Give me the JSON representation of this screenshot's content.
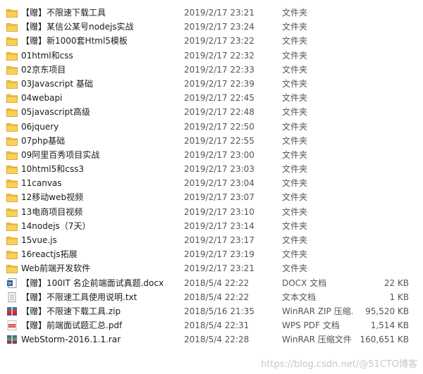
{
  "files": [
    {
      "name": "【赠】不限速下载工具",
      "date": "2019/2/17 23:21",
      "type": "文件夹",
      "size": "",
      "icon": "folder-icon"
    },
    {
      "name": "【赠】某信公某号nodejs实战",
      "date": "2019/2/17 23:24",
      "type": "文件夹",
      "size": "",
      "icon": "folder-icon"
    },
    {
      "name": "【赠】新1000套Html5模板",
      "date": "2019/2/17 23:22",
      "type": "文件夹",
      "size": "",
      "icon": "folder-icon"
    },
    {
      "name": "01html和css",
      "date": "2019/2/17 22:32",
      "type": "文件夹",
      "size": "",
      "icon": "folder-icon"
    },
    {
      "name": "02京东项目",
      "date": "2019/2/17 22:33",
      "type": "文件夹",
      "size": "",
      "icon": "folder-icon"
    },
    {
      "name": "03Javascript 基础",
      "date": "2019/2/17 22:39",
      "type": "文件夹",
      "size": "",
      "icon": "folder-icon"
    },
    {
      "name": "04webapi",
      "date": "2019/2/17 22:45",
      "type": "文件夹",
      "size": "",
      "icon": "folder-icon"
    },
    {
      "name": "05javascript高级",
      "date": "2019/2/17 22:48",
      "type": "文件夹",
      "size": "",
      "icon": "folder-icon"
    },
    {
      "name": "06jquery",
      "date": "2019/2/17 22:50",
      "type": "文件夹",
      "size": "",
      "icon": "folder-icon"
    },
    {
      "name": "07php基础",
      "date": "2019/2/17 22:55",
      "type": "文件夹",
      "size": "",
      "icon": "folder-icon"
    },
    {
      "name": "09阿里百秀项目实战",
      "date": "2019/2/17 23:00",
      "type": "文件夹",
      "size": "",
      "icon": "folder-icon"
    },
    {
      "name": "10html5和css3",
      "date": "2019/2/17 23:03",
      "type": "文件夹",
      "size": "",
      "icon": "folder-icon"
    },
    {
      "name": "11canvas",
      "date": "2019/2/17 23:04",
      "type": "文件夹",
      "size": "",
      "icon": "folder-icon"
    },
    {
      "name": "12移动web视频",
      "date": "2019/2/17 23:07",
      "type": "文件夹",
      "size": "",
      "icon": "folder-icon"
    },
    {
      "name": "13电商项目视频",
      "date": "2019/2/17 23:10",
      "type": "文件夹",
      "size": "",
      "icon": "folder-icon"
    },
    {
      "name": "14nodejs（7天）",
      "date": "2019/2/17 23:14",
      "type": "文件夹",
      "size": "",
      "icon": "folder-icon"
    },
    {
      "name": "15vue.js",
      "date": "2019/2/17 23:17",
      "type": "文件夹",
      "size": "",
      "icon": "folder-icon"
    },
    {
      "name": "16reactjs拓展",
      "date": "2019/2/17 23:19",
      "type": "文件夹",
      "size": "",
      "icon": "folder-icon"
    },
    {
      "name": "Web前端开发软件",
      "date": "2019/2/17 23:21",
      "type": "文件夹",
      "size": "",
      "icon": "folder-icon"
    },
    {
      "name": "【赠】100IT 名企前端面试真题.docx",
      "date": "2018/5/4 22:22",
      "type": "DOCX 文档",
      "size": "22 KB",
      "icon": "docx-icon"
    },
    {
      "name": "【赠】不限速工具使用说明.txt",
      "date": "2018/5/4 22:22",
      "type": "文本文档",
      "size": "1 KB",
      "icon": "txt-icon"
    },
    {
      "name": "【赠】不限速下载工具.zip",
      "date": "2018/5/16 21:35",
      "type": "WinRAR ZIP 压缩...",
      "size": "95,520 KB",
      "icon": "zip-icon"
    },
    {
      "name": "【赠】前端面试题汇总.pdf",
      "date": "2018/5/4 22:31",
      "type": "WPS PDF 文档",
      "size": "1,514 KB",
      "icon": "pdf-icon"
    },
    {
      "name": "WebStorm-2016.1.1.rar",
      "date": "2018/5/4 22:28",
      "type": "WinRAR 压缩文件",
      "size": "160,651 KB",
      "icon": "rar-icon"
    }
  ],
  "watermark": "https://blog.csdn.net/@51CTO博客",
  "colors": {
    "folder": "#f5c542",
    "folder_dark": "#e0a82e",
    "docx": "#2b5797",
    "pdf": "#d9342b",
    "rar": "#8b2f8f"
  }
}
